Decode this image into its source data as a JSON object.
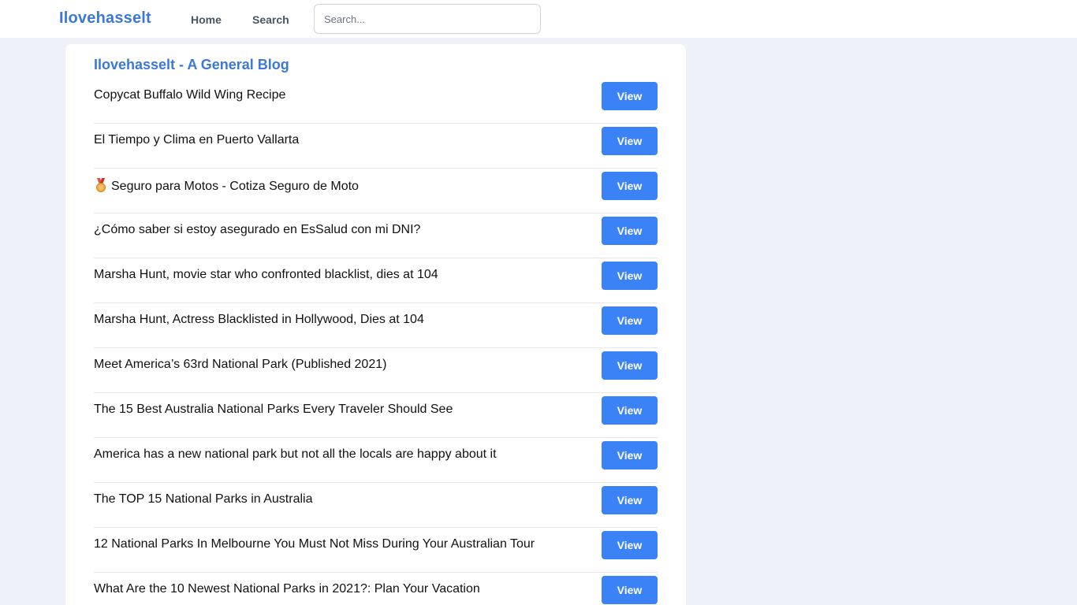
{
  "header": {
    "brand": "Ilovehasselt",
    "nav": [
      {
        "label": "Home"
      },
      {
        "label": "Search"
      }
    ],
    "search": {
      "placeholder": "Search...",
      "value": ""
    }
  },
  "main": {
    "title": "Ilovehasselt - A General Blog",
    "button_label": "View",
    "posts": [
      {
        "title": "Copycat Buffalo Wild Wing Recipe"
      },
      {
        "title": "El Tiempo y Clima en Puerto Vallarta"
      },
      {
        "title": "Seguro para Motos - Cotiza Seguro de Moto",
        "icon": "medal-icon"
      },
      {
        "title": "¿Cómo saber si estoy asegurado en EsSalud con mi DNI?"
      },
      {
        "title": "Marsha Hunt, movie star who confronted blacklist, dies at 104"
      },
      {
        "title": "Marsha Hunt, Actress Blacklisted in Hollywood, Dies at 104"
      },
      {
        "title": "Meet America’s 63rd National Park (Published 2021)"
      },
      {
        "title": "The 15 Best Australia National Parks Every Traveler Should See"
      },
      {
        "title": "America has a new national park but not all the locals are happy about it"
      },
      {
        "title": "The TOP 15 National Parks in Australia"
      },
      {
        "title": "12 National Parks In Melbourne You Must Not Miss During Your Australian Tour"
      },
      {
        "title": "What Are the 10 Newest National Parks in 2021?: Plan Your Vacation"
      }
    ]
  },
  "colors": {
    "accent": "#3b78d8",
    "button": "#3b82f6",
    "background": "#eef2f8"
  }
}
